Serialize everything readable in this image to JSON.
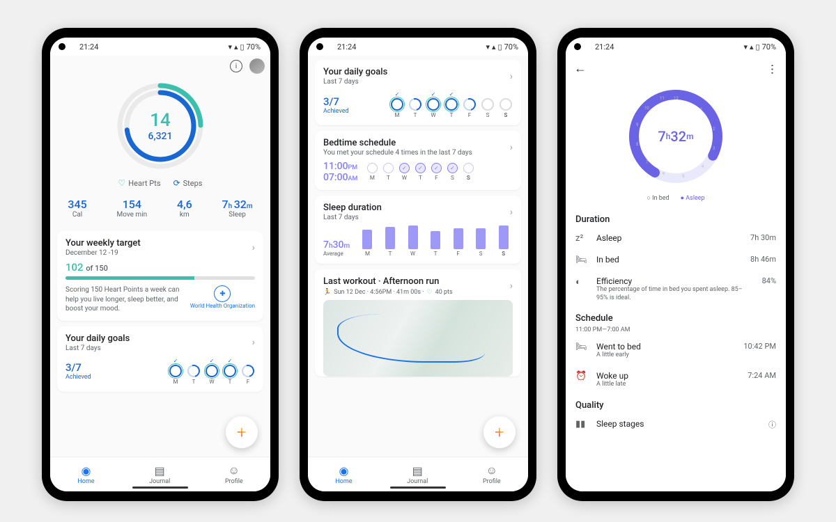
{
  "status": {
    "time": "21:24",
    "battery": "70%"
  },
  "screen1": {
    "heart_points": "14",
    "steps": "6,321",
    "legend": {
      "heart": "Heart Pts",
      "steps": "Steps"
    },
    "stats": {
      "cal": {
        "val": "345",
        "unit": "Cal"
      },
      "move": {
        "val": "154",
        "unit": "Move min"
      },
      "km": {
        "val": "4,6",
        "unit": "km"
      },
      "sleep": {
        "val_h": "7",
        "val_m": "32",
        "unit": "Sleep"
      }
    },
    "weekly": {
      "title": "Your weekly target",
      "dates": "December 12 -19",
      "score": "102",
      "of_label": "of 150",
      "text": "Scoring 150 Heart Points a week can help you live longer, sleep better, and boost your mood.",
      "who": "World Health Organization"
    },
    "daily": {
      "title": "Your daily goals",
      "sub": "Last 7 days",
      "achieved": "3/7",
      "achieved_lbl": "Achieved",
      "days": [
        "M",
        "T",
        "W",
        "T",
        "F"
      ]
    }
  },
  "screen2": {
    "daily": {
      "title": "Your daily goals",
      "sub": "Last 7 days",
      "achieved": "3/7",
      "achieved_lbl": "Achieved",
      "days": [
        "M",
        "T",
        "W",
        "T",
        "F",
        "S",
        "S"
      ]
    },
    "bedtime": {
      "title": "Bedtime schedule",
      "sub": "You met your schedule 4 times in the last 7 days",
      "bed": "11:00",
      "bed_ampm": "PM",
      "wake": "07:00",
      "wake_ampm": "AM",
      "days": [
        "M",
        "T",
        "W",
        "T",
        "F",
        "S",
        "S"
      ],
      "met": [
        false,
        false,
        true,
        true,
        true,
        true,
        false
      ]
    },
    "sleep": {
      "title": "Sleep duration",
      "sub": "Last 7 days",
      "avg_h": "7",
      "avg_m": "30",
      "avg_lbl": "Average",
      "days": [
        "M",
        "T",
        "W",
        "T",
        "F",
        "S",
        "S"
      ],
      "bars": [
        28,
        32,
        34,
        26,
        30,
        30,
        34
      ]
    },
    "workout": {
      "title": "Last workout · Afternoon run",
      "meta_icon": "🏃",
      "meta": "Sun 12 Dec · 4:56PM · 41m 00s ·",
      "pts": "40 pts"
    }
  },
  "screen3": {
    "duration_h": "7",
    "duration_m": "32",
    "legend_inbed": "In bed",
    "legend_asleep": "Asleep",
    "sections": {
      "duration": "Duration",
      "schedule": "Schedule",
      "quality": "Quality"
    },
    "asleep": {
      "title": "Asleep",
      "val": "7h 30m"
    },
    "inbed": {
      "title": "In bed",
      "val": "8h 46m"
    },
    "efficiency": {
      "title": "Efficiency",
      "sub": "The percentage of time in bed you spent asleep. 85–95% is ideal.",
      "val": "84%"
    },
    "schedule_sub": "11:00 PM—7:00 AM",
    "went": {
      "title": "Went to bed",
      "sub": "A little early",
      "val": "10:42 PM"
    },
    "woke": {
      "title": "Woke up",
      "sub": "A little late",
      "val": "7:24 AM"
    },
    "stages": "Sleep stages"
  },
  "nav": {
    "home": "Home",
    "journal": "Journal",
    "profile": "Profile"
  }
}
